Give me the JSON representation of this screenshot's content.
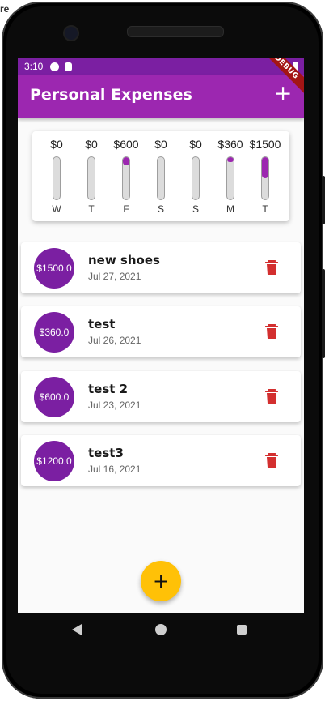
{
  "host": {
    "corner_text": "re"
  },
  "status_bar": {
    "time": "3:10"
  },
  "debug_banner": {
    "label": "DEBUG"
  },
  "app_bar": {
    "title": "Personal Expenses",
    "add_icon": "plus-icon"
  },
  "chart_data": {
    "type": "bar",
    "categories": [
      "W",
      "T",
      "F",
      "S",
      "S",
      "M",
      "T"
    ],
    "amount_labels": [
      "$0",
      "$0",
      "$600",
      "$0",
      "$0",
      "$360",
      "$1500"
    ],
    "values": [
      0,
      0,
      600,
      0,
      0,
      360,
      1500
    ],
    "fill_fraction": [
      0,
      0,
      0.2,
      0,
      0,
      0.12,
      0.5
    ],
    "bar_color": "#9c27b0",
    "track_color": "#dcdcdc"
  },
  "transactions": [
    {
      "amount": "$1500.0",
      "title": "new shoes",
      "date": "Jul 27, 2021"
    },
    {
      "amount": "$360.0",
      "title": "test",
      "date": "Jul 26, 2021"
    },
    {
      "amount": "$600.0",
      "title": "test 2",
      "date": "Jul 23, 2021"
    },
    {
      "amount": "$1200.0",
      "title": "test3",
      "date": "Jul 16, 2021"
    }
  ],
  "fab": {
    "icon": "plus-icon"
  },
  "colors": {
    "primary": "#9c27b0",
    "primary_dark": "#7b1fa2",
    "accent": "#ffc107",
    "delete": "#d32f2f"
  }
}
